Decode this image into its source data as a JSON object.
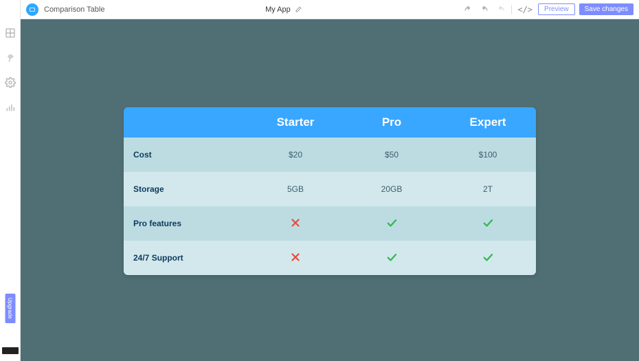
{
  "topbar": {
    "title": "Comparison Table",
    "app_name": "My App",
    "preview_label": "Preview",
    "save_label": "Save changes"
  },
  "sidebar": {
    "upgrade_label": "Upgrade"
  },
  "table": {
    "columns": [
      "Starter",
      "Pro",
      "Expert"
    ],
    "rows": [
      {
        "label": "Cost",
        "values": [
          "$20",
          "$50",
          "$100"
        ],
        "type": "text"
      },
      {
        "label": "Storage",
        "values": [
          "5GB",
          "20GB",
          "2T"
        ],
        "type": "text"
      },
      {
        "label": "Pro features",
        "values": [
          false,
          true,
          true
        ],
        "type": "bool"
      },
      {
        "label": "24/7 Support",
        "values": [
          false,
          true,
          true
        ],
        "type": "bool"
      }
    ]
  }
}
